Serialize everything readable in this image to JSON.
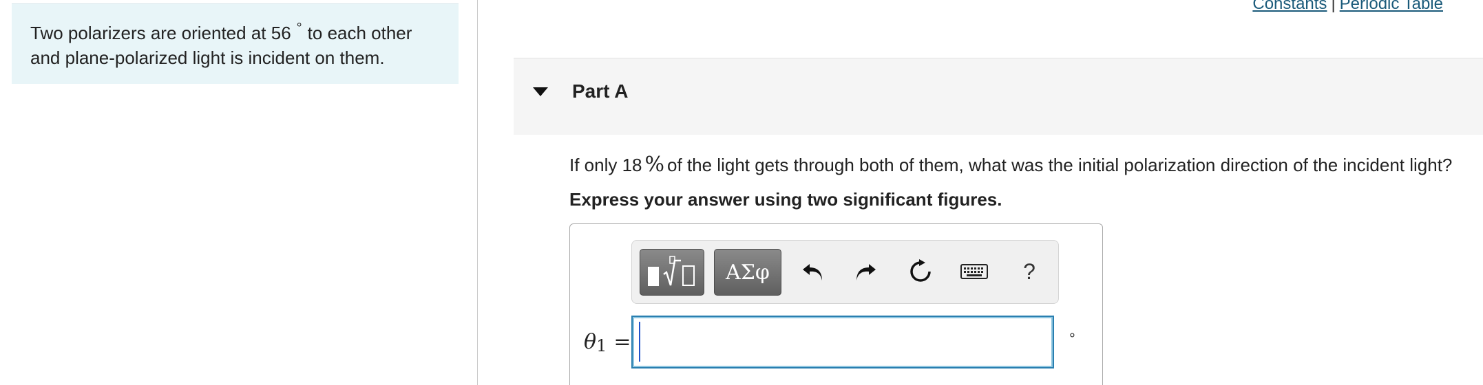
{
  "intro": {
    "line1_pre": "Two polarizers are oriented at 56",
    "degree": "°",
    "line1_post": "to each other",
    "line2": "and plane-polarized light is incident on them."
  },
  "top_links": {
    "constants": "Constants",
    "separator": "|",
    "periodic_table": "Periodic Table"
  },
  "part": {
    "title": "Part A"
  },
  "question": {
    "pre": "If only 18",
    "percent": "%",
    "post": "of the light gets through both of them, what was the initial polarization direction of the incident light?",
    "instruction": "Express your answer using two significant figures."
  },
  "toolbar": {
    "symbols_label": "ΑΣφ",
    "help_label": "?"
  },
  "answer": {
    "variable": "θ",
    "subscript": "1",
    "equals": "=",
    "value": "",
    "unit": "°"
  },
  "colors": {
    "intro_bg": "#e8f5f8",
    "link": "#1a5a7a",
    "input_border": "#2a7fb0"
  }
}
